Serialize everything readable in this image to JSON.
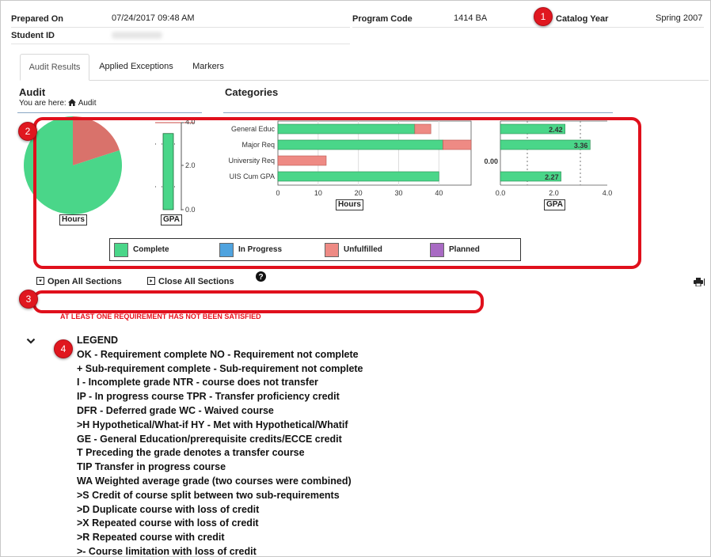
{
  "header": {
    "prepared_on_label": "Prepared On",
    "prepared_on_value": "07/24/2017 09:48 AM",
    "program_code_label": "Program Code",
    "program_code_value": "1414 BA",
    "catalog_year_label": "Catalog Year",
    "catalog_year_value": "Spring 2007",
    "student_id_label": "Student ID"
  },
  "tabs": [
    {
      "label": "Audit Results",
      "active": true
    },
    {
      "label": "Applied Exceptions",
      "active": false
    },
    {
      "label": "Markers",
      "active": false
    }
  ],
  "audit": {
    "title": "Audit",
    "breadcrumb_prefix": "You are here:",
    "breadcrumb_icon": "home-icon",
    "breadcrumb_item": "Audit"
  },
  "categories_title": "Categories",
  "callouts": [
    "1",
    "2",
    "3",
    "4"
  ],
  "colors": {
    "complete": "#4ad689",
    "in_progress": "#4fa3df",
    "unfulfilled": "#ee8a84",
    "planned": "#a86ac3",
    "pie_unfulfilled": "#d9726b",
    "callout_red": "#e0171f"
  },
  "chart_data": [
    {
      "type": "pie",
      "xlabel": "Hours",
      "slices": [
        {
          "label": "Complete",
          "value": 0.8
        },
        {
          "label": "Unfulfilled",
          "value": 0.2
        }
      ]
    },
    {
      "type": "bar",
      "xlabel": "GPA",
      "ylim": [
        0,
        4.0
      ],
      "ticks": [
        "0.0",
        "2.0",
        "4.0"
      ],
      "values": [
        3.5
      ]
    },
    {
      "type": "bar",
      "orientation": "horizontal",
      "xlabel": "Hours",
      "categories": [
        "General Educ",
        "Major Req",
        "University Req",
        "UIS Cum GPA"
      ],
      "xlim": [
        0,
        48
      ],
      "ticks": [
        "0",
        "10",
        "20",
        "30",
        "40"
      ],
      "series": [
        {
          "name": "Complete",
          "values": [
            34,
            41,
            0,
            40
          ]
        },
        {
          "name": "Unfulfilled",
          "values": [
            4,
            7,
            12,
            0
          ]
        }
      ]
    },
    {
      "type": "bar",
      "orientation": "horizontal",
      "xlabel": "GPA",
      "categories": [
        "General Educ",
        "Major Req",
        "University Req",
        "UIS Cum GPA"
      ],
      "xlim": [
        0,
        4.0
      ],
      "ticks": [
        "0.0",
        "2.0",
        "4.0"
      ],
      "values": [
        2.42,
        3.36,
        0.0,
        2.27
      ],
      "value_labels": [
        "2.42",
        "3.36",
        "0.00",
        "2.27"
      ]
    }
  ],
  "legend_keys": [
    {
      "label": "Complete"
    },
    {
      "label": "In Progress"
    },
    {
      "label": "Unfulfilled"
    },
    {
      "label": "Planned"
    }
  ],
  "controls": {
    "open_all": "Open All Sections",
    "close_all": "Close All Sections",
    "help_icon": "help-icon",
    "print_icon": "print-icon"
  },
  "warning": "AT LEAST ONE REQUIREMENT HAS NOT BEEN SATISFIED",
  "legend": {
    "title": "LEGEND",
    "lines": [
      "OK - Requirement complete NO - Requirement not complete",
      "+ Sub-requirement complete - Sub-requirement not complete",
      "I - Incomplete grade NTR - course does not transfer",
      "IP - In progress course TPR - Transfer proficiency credit",
      "DFR - Deferred grade WC - Waived course",
      ">H Hypothetical/What-if HY - Met with Hypothetical/Whatif",
      "GE - General Education/prerequisite credits/ECCE credit",
      "T Preceding the grade denotes a transfer course",
      "TIP Transfer in progress course",
      "WA Weighted average grade (two courses were combined)",
      ">S Credit of course split between two sub-requirements",
      ">D Duplicate course with loss of credit",
      ">X Repeated course with loss of credit",
      ">R Repeated course with credit",
      ">- Course limitation with loss of credit"
    ]
  }
}
